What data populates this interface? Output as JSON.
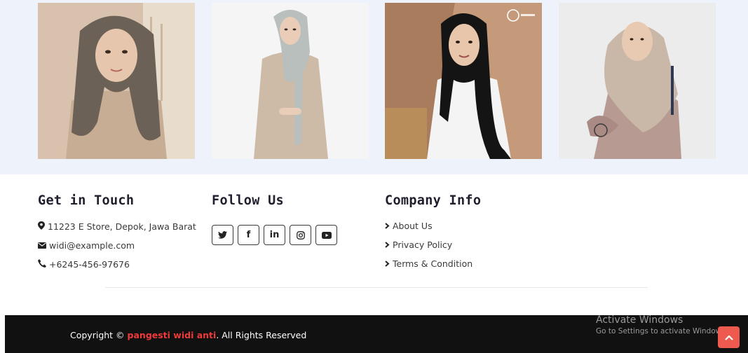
{
  "gallery": {
    "images": [
      {
        "alt": "model wearing brown hijab",
        "colors": {
          "bg": "#c9a98e",
          "garment": "#6b6156",
          "skin": "#e6c6ad"
        }
      },
      {
        "alt": "model wearing light grey hijab",
        "colors": {
          "bg": "#f4f4f4",
          "garment": "#b8bfbd",
          "skin": "#e9cdb8"
        }
      },
      {
        "alt": "model wearing black hijab",
        "colors": {
          "bg": "#b88a69",
          "garment": "#141414",
          "skin": "#e7c6ab"
        }
      },
      {
        "alt": "model wearing beige hijab",
        "colors": {
          "bg": "#e8e8e8",
          "garment": "#c9b7a8",
          "skin": "#e8c9b2"
        }
      }
    ],
    "watermark_logo": "G"
  },
  "contact": {
    "title": "Get in Touch",
    "address": "11223 E Store, Depok, Jawa Barat",
    "email": "widi@example.com",
    "phone": "+6245-456-97676",
    "icons": [
      "map-marker-icon",
      "envelope-icon",
      "phone-icon"
    ]
  },
  "follow": {
    "title": "Follow Us",
    "networks": [
      {
        "name": "twitter-icon",
        "glyph": "🐦"
      },
      {
        "name": "facebook-icon",
        "glyph": "f"
      },
      {
        "name": "linkedin-icon",
        "glyph": "in"
      },
      {
        "name": "instagram-icon",
        "glyph": "◎"
      },
      {
        "name": "youtube-icon",
        "glyph": "▶"
      }
    ]
  },
  "company": {
    "title": "Company Info",
    "links": [
      "About Us",
      "Privacy Policy",
      "Terms & Condition"
    ]
  },
  "footer": {
    "prefix": "Copyright © ",
    "brand": "pangesti widi anti",
    "suffix": ". All Rights Reserved"
  },
  "overlay": {
    "activate_title": "Activate Windows",
    "activate_sub": "Go to Settings to activate Windows."
  },
  "colors": {
    "accent": "#ef3a3a",
    "footer_bg": "#111111",
    "gallery_bg": "#eef2fb",
    "back_to_top": "#ef5a4e"
  }
}
